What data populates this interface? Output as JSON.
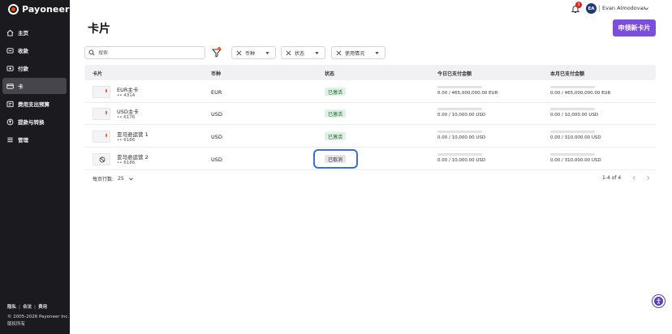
{
  "brand": {
    "name": "Payoneer",
    "accent": "#ff4800"
  },
  "nav": {
    "items": [
      {
        "label": "主页",
        "icon": "home-icon"
      },
      {
        "label": "收款",
        "icon": "receive-icon"
      },
      {
        "label": "付款",
        "icon": "pay-icon"
      },
      {
        "label": "卡",
        "icon": "card-icon",
        "active": true
      },
      {
        "label": "费用支出预算",
        "icon": "budget-icon"
      },
      {
        "label": "提款与转换",
        "icon": "withdraw-icon"
      },
      {
        "label": "管理",
        "icon": "manage-icon"
      }
    ]
  },
  "footer": {
    "links": [
      "隐私",
      "合法",
      "费用"
    ],
    "copyright": "© 2005-2026 Payoneer Inc.",
    "rights": "版权所有"
  },
  "topbar": {
    "notification_count": "3",
    "avatar_initials": "EA",
    "user_name": "Evan Almodovar"
  },
  "page": {
    "title": "卡片",
    "apply_button": "申领新卡片"
  },
  "filters": {
    "search_placeholder": "搜索",
    "chips": [
      "币种",
      "状态",
      "使用情况"
    ]
  },
  "table": {
    "headers": [
      "卡片",
      "币种",
      "状态",
      "今日已支付金额",
      "本月已支付金额"
    ],
    "rows": [
      {
        "name": "EUR主卡",
        "number": "•• 4314",
        "currency": "EUR",
        "status": "已激活",
        "status_type": "active",
        "today": "0.00 / 465,000,000.00 EUR",
        "month": "0.00 / 465,000,000.00 EUR"
      },
      {
        "name": "USD主卡",
        "number": "•• 6176",
        "currency": "USD",
        "status": "已激活",
        "status_type": "active",
        "today": "0.00 / 10,000.00 USD",
        "month": "0.00 / 10,000.00 USD"
      },
      {
        "name": "亚马逊运营 1",
        "number": "•• 6186",
        "currency": "USD",
        "status": "已激活",
        "status_type": "active",
        "today": "0.00 / 10,000.00 USD",
        "month": "0.00 / 310,000.00 USD"
      },
      {
        "name": "亚马逊运营 2",
        "number": "•• 6186",
        "currency": "USD",
        "status": "已取消",
        "status_type": "cancelled",
        "today": "0.00 / 10,000.00 USD",
        "month": "0.00 / 310,000.00 USD"
      }
    ]
  },
  "pagination": {
    "rows_per_page_label": "每页行数:",
    "rows_per_page": "25",
    "range": "1-4 of 4"
  },
  "colors": {
    "primary_button": "#7b4fdc",
    "sidebar_bg": "#1b1b1f",
    "active_status_bg": "#dff3e4",
    "focus_ring": "#3c6fcf"
  }
}
